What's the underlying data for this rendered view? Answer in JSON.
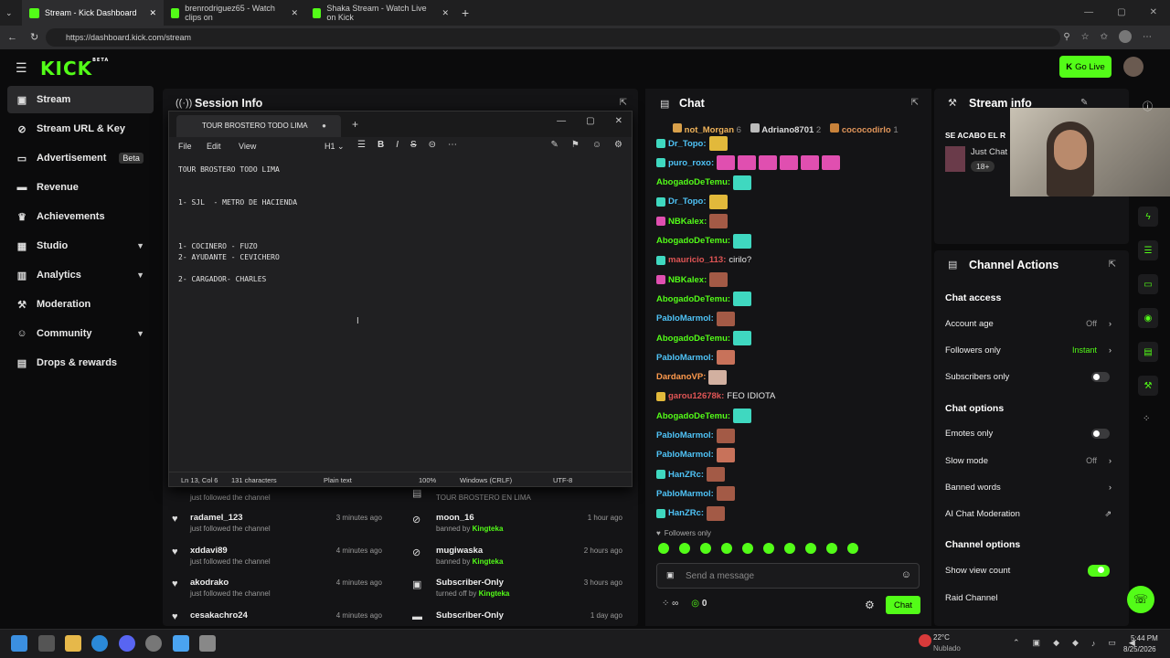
{
  "browser": {
    "tabs": [
      {
        "label": "Stream - Kick Dashboard"
      },
      {
        "label": "brenrodriguez65 - Watch clips on"
      },
      {
        "label": "Shaka Stream - Watch Live on Kick"
      }
    ],
    "url": "https://dashboard.kick.com/stream"
  },
  "header": {
    "logo": "KICK",
    "logo_sup": "BETA",
    "go_live": "Go Live"
  },
  "sidebar": {
    "items": [
      {
        "label": "Stream",
        "icon": "broadcast-icon"
      },
      {
        "label": "Stream URL & Key",
        "icon": "link-icon"
      },
      {
        "label": "Advertisement",
        "badge": "Beta",
        "icon": "ad-icon"
      },
      {
        "label": "Revenue",
        "icon": "wallet-icon"
      },
      {
        "label": "Achievements",
        "icon": "trophy-icon"
      },
      {
        "label": "Studio",
        "icon": "studio-icon"
      },
      {
        "label": "Analytics",
        "icon": "chart-icon"
      },
      {
        "label": "Moderation",
        "icon": "hammer-icon"
      },
      {
        "label": "Community",
        "icon": "people-icon"
      },
      {
        "label": "Drops & rewards",
        "icon": "gift-icon"
      }
    ]
  },
  "session": {
    "title": "Session Info"
  },
  "editor": {
    "tab_title": "TOUR BROSTERO TODO LIMA",
    "menu": [
      "File",
      "Edit",
      "View"
    ],
    "heading": "H1",
    "content": "TOUR BROSTERO TODO LIMA\n\n\n1- SJL  - METRO DE HACIENDA\n\n\n\n1- COCINERO - FUZO\n2- AYUDANTE - CEVICHERO\n\n2- CARGADOR- CHARLES",
    "status": {
      "position": "Ln 13, Col 6",
      "chars": "131 characters",
      "format": "Plain text",
      "zoom": "100%",
      "eol": "Windows (CRLF)",
      "encoding": "UTF-8"
    }
  },
  "activity": {
    "left": [
      {
        "name": "",
        "desc": "just followed the channel",
        "time": ""
      },
      {
        "name": "radamel_123",
        "desc": "just followed the channel",
        "time": "3 minutes ago"
      },
      {
        "name": "xddavi89",
        "desc": "just followed the channel",
        "time": "4 minutes ago"
      },
      {
        "name": "akodrako",
        "desc": "just followed the channel",
        "time": "4 minutes ago"
      },
      {
        "name": "cesakachro24",
        "desc": "",
        "time": "4 minutes ago"
      }
    ],
    "right": [
      {
        "name": "",
        "desc": "TOUR BROSTERO EN LIMA",
        "time": ""
      },
      {
        "name": "moon_16",
        "desc": "banned by",
        "by": "Kingteka",
        "time": "1 hour ago"
      },
      {
        "name": "mugiwaska",
        "desc": "banned by",
        "by": "Kingteka",
        "time": "2 hours ago"
      },
      {
        "name": "Subscriber-Only",
        "desc": "turned off by",
        "by": "Kingteka",
        "time": "3 hours ago"
      },
      {
        "name": "Subscriber-Only",
        "desc": "",
        "time": "1 day ago"
      }
    ]
  },
  "chat": {
    "title": "Chat",
    "top": [
      {
        "name": "not_Morgan",
        "count": "6"
      },
      {
        "name": "Adriano8701",
        "count": "2"
      },
      {
        "name": "cococodirlo",
        "count": "1"
      }
    ],
    "messages": [
      {
        "user": "Dr_Topo:",
        "color": "#4fc3f7",
        "text": ""
      },
      {
        "user": "puro_roxo:",
        "color": "#4fc3f7",
        "text": ""
      },
      {
        "user": "AbogadoDeTemu:",
        "color": "#53fc18",
        "text": ""
      },
      {
        "user": "Dr_Topo:",
        "color": "#4fc3f7",
        "text": ""
      },
      {
        "user": "NBKalex:",
        "color": "#53fc18",
        "text": ""
      },
      {
        "user": "AbogadoDeTemu:",
        "color": "#53fc18",
        "text": ""
      },
      {
        "user": "mauricio_113:",
        "color": "#e05555",
        "text": "cirilo?"
      },
      {
        "user": "NBKalex:",
        "color": "#53fc18",
        "text": ""
      },
      {
        "user": "AbogadoDeTemu:",
        "color": "#53fc18",
        "text": ""
      },
      {
        "user": "PabloMarmol:",
        "color": "#4fc3f7",
        "text": ""
      },
      {
        "user": "AbogadoDeTemu:",
        "color": "#53fc18",
        "text": ""
      },
      {
        "user": "PabloMarmol:",
        "color": "#4fc3f7",
        "text": ""
      },
      {
        "user": "DardanoVP:",
        "color": "#ff9a4d",
        "text": ""
      },
      {
        "user": "garou12678k:",
        "color": "#e05555",
        "text": "FEO IDIOTA"
      },
      {
        "user": "AbogadoDeTemu:",
        "color": "#53fc18",
        "text": ""
      },
      {
        "user": "PabloMarmol:",
        "color": "#4fc3f7",
        "text": ""
      },
      {
        "user": "PabloMarmol:",
        "color": "#4fc3f7",
        "text": ""
      },
      {
        "user": "HanZRc:",
        "color": "#4fc3f7",
        "text": ""
      },
      {
        "user": "PabloMarmol:",
        "color": "#4fc3f7",
        "text": ""
      },
      {
        "user": "HanZRc:",
        "color": "#4fc3f7",
        "text": ""
      }
    ],
    "followers_only": "Followers only",
    "placeholder": "Send a message",
    "count": "0",
    "send": "Chat"
  },
  "stream_info": {
    "title": "Stream info",
    "stream_title": "SE ACABO EL R",
    "category": "Just Chat",
    "tag": "18+"
  },
  "channel_actions": {
    "title": "Channel Actions",
    "chat_access": "Chat access",
    "account_age": "Account age",
    "account_age_val": "Off",
    "followers_only": "Followers only",
    "followers_only_val": "Instant",
    "subscribers_only": "Subscribers only",
    "chat_options": "Chat options",
    "emotes_only": "Emotes only",
    "slow_mode": "Slow mode",
    "slow_mode_val": "Off",
    "banned_words": "Banned words",
    "ai_mod": "AI Chat Moderation",
    "channel_options": "Channel options",
    "view_count": "Show view count",
    "raid": "Raid Channel"
  },
  "taskbar": {
    "temp": "22°C",
    "weather": "Nublado",
    "time": "5:44 PM",
    "date": "8/25/2026"
  },
  "colors": {
    "accent": "#53fc18"
  }
}
